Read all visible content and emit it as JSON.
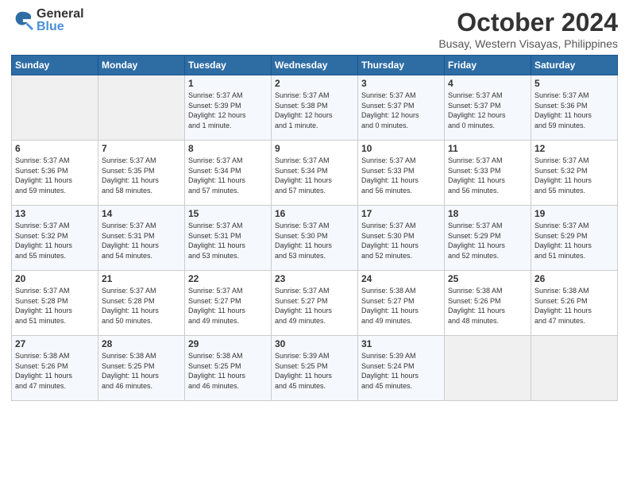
{
  "logo": {
    "general": "General",
    "blue": "Blue"
  },
  "title": "October 2024",
  "location": "Busay, Western Visayas, Philippines",
  "headers": [
    "Sunday",
    "Monday",
    "Tuesday",
    "Wednesday",
    "Thursday",
    "Friday",
    "Saturday"
  ],
  "weeks": [
    [
      {
        "day": "",
        "info": ""
      },
      {
        "day": "",
        "info": ""
      },
      {
        "day": "1",
        "info": "Sunrise: 5:37 AM\nSunset: 5:39 PM\nDaylight: 12 hours\nand 1 minute."
      },
      {
        "day": "2",
        "info": "Sunrise: 5:37 AM\nSunset: 5:38 PM\nDaylight: 12 hours\nand 1 minute."
      },
      {
        "day": "3",
        "info": "Sunrise: 5:37 AM\nSunset: 5:37 PM\nDaylight: 12 hours\nand 0 minutes."
      },
      {
        "day": "4",
        "info": "Sunrise: 5:37 AM\nSunset: 5:37 PM\nDaylight: 12 hours\nand 0 minutes."
      },
      {
        "day": "5",
        "info": "Sunrise: 5:37 AM\nSunset: 5:36 PM\nDaylight: 11 hours\nand 59 minutes."
      }
    ],
    [
      {
        "day": "6",
        "info": "Sunrise: 5:37 AM\nSunset: 5:36 PM\nDaylight: 11 hours\nand 59 minutes."
      },
      {
        "day": "7",
        "info": "Sunrise: 5:37 AM\nSunset: 5:35 PM\nDaylight: 11 hours\nand 58 minutes."
      },
      {
        "day": "8",
        "info": "Sunrise: 5:37 AM\nSunset: 5:34 PM\nDaylight: 11 hours\nand 57 minutes."
      },
      {
        "day": "9",
        "info": "Sunrise: 5:37 AM\nSunset: 5:34 PM\nDaylight: 11 hours\nand 57 minutes."
      },
      {
        "day": "10",
        "info": "Sunrise: 5:37 AM\nSunset: 5:33 PM\nDaylight: 11 hours\nand 56 minutes."
      },
      {
        "day": "11",
        "info": "Sunrise: 5:37 AM\nSunset: 5:33 PM\nDaylight: 11 hours\nand 56 minutes."
      },
      {
        "day": "12",
        "info": "Sunrise: 5:37 AM\nSunset: 5:32 PM\nDaylight: 11 hours\nand 55 minutes."
      }
    ],
    [
      {
        "day": "13",
        "info": "Sunrise: 5:37 AM\nSunset: 5:32 PM\nDaylight: 11 hours\nand 55 minutes."
      },
      {
        "day": "14",
        "info": "Sunrise: 5:37 AM\nSunset: 5:31 PM\nDaylight: 11 hours\nand 54 minutes."
      },
      {
        "day": "15",
        "info": "Sunrise: 5:37 AM\nSunset: 5:31 PM\nDaylight: 11 hours\nand 53 minutes."
      },
      {
        "day": "16",
        "info": "Sunrise: 5:37 AM\nSunset: 5:30 PM\nDaylight: 11 hours\nand 53 minutes."
      },
      {
        "day": "17",
        "info": "Sunrise: 5:37 AM\nSunset: 5:30 PM\nDaylight: 11 hours\nand 52 minutes."
      },
      {
        "day": "18",
        "info": "Sunrise: 5:37 AM\nSunset: 5:29 PM\nDaylight: 11 hours\nand 52 minutes."
      },
      {
        "day": "19",
        "info": "Sunrise: 5:37 AM\nSunset: 5:29 PM\nDaylight: 11 hours\nand 51 minutes."
      }
    ],
    [
      {
        "day": "20",
        "info": "Sunrise: 5:37 AM\nSunset: 5:28 PM\nDaylight: 11 hours\nand 51 minutes."
      },
      {
        "day": "21",
        "info": "Sunrise: 5:37 AM\nSunset: 5:28 PM\nDaylight: 11 hours\nand 50 minutes."
      },
      {
        "day": "22",
        "info": "Sunrise: 5:37 AM\nSunset: 5:27 PM\nDaylight: 11 hours\nand 49 minutes."
      },
      {
        "day": "23",
        "info": "Sunrise: 5:37 AM\nSunset: 5:27 PM\nDaylight: 11 hours\nand 49 minutes."
      },
      {
        "day": "24",
        "info": "Sunrise: 5:38 AM\nSunset: 5:27 PM\nDaylight: 11 hours\nand 49 minutes."
      },
      {
        "day": "25",
        "info": "Sunrise: 5:38 AM\nSunset: 5:26 PM\nDaylight: 11 hours\nand 48 minutes."
      },
      {
        "day": "26",
        "info": "Sunrise: 5:38 AM\nSunset: 5:26 PM\nDaylight: 11 hours\nand 47 minutes."
      }
    ],
    [
      {
        "day": "27",
        "info": "Sunrise: 5:38 AM\nSunset: 5:26 PM\nDaylight: 11 hours\nand 47 minutes."
      },
      {
        "day": "28",
        "info": "Sunrise: 5:38 AM\nSunset: 5:25 PM\nDaylight: 11 hours\nand 46 minutes."
      },
      {
        "day": "29",
        "info": "Sunrise: 5:38 AM\nSunset: 5:25 PM\nDaylight: 11 hours\nand 46 minutes."
      },
      {
        "day": "30",
        "info": "Sunrise: 5:39 AM\nSunset: 5:25 PM\nDaylight: 11 hours\nand 45 minutes."
      },
      {
        "day": "31",
        "info": "Sunrise: 5:39 AM\nSunset: 5:24 PM\nDaylight: 11 hours\nand 45 minutes."
      },
      {
        "day": "",
        "info": ""
      },
      {
        "day": "",
        "info": ""
      }
    ]
  ]
}
